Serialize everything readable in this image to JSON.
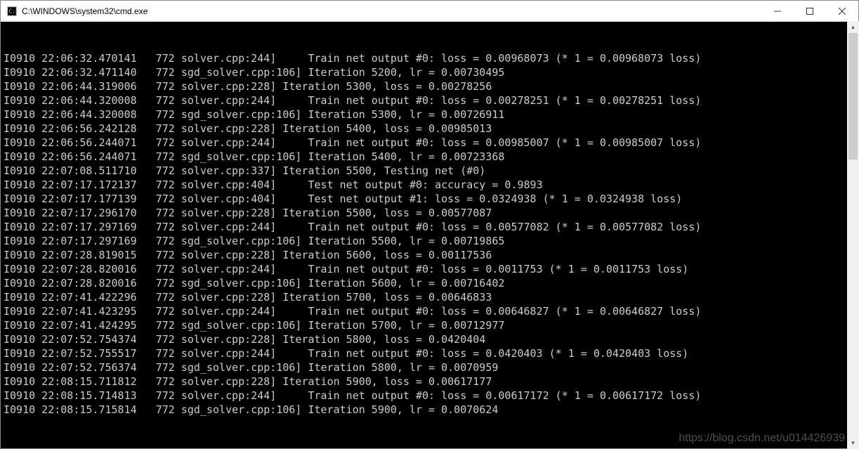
{
  "window": {
    "title": "C:\\WINDOWS\\system32\\cmd.exe"
  },
  "terminal": {
    "lines": [
      "I0910 22:06:32.470141   772 solver.cpp:244]     Train net output #0: loss = 0.00968073 (* 1 = 0.00968073 loss)",
      "I0910 22:06:32.471140   772 sgd_solver.cpp:106] Iteration 5200, lr = 0.00730495",
      "I0910 22:06:44.319006   772 solver.cpp:228] Iteration 5300, loss = 0.00278256",
      "I0910 22:06:44.320008   772 solver.cpp:244]     Train net output #0: loss = 0.00278251 (* 1 = 0.00278251 loss)",
      "I0910 22:06:44.320008   772 sgd_solver.cpp:106] Iteration 5300, lr = 0.00726911",
      "I0910 22:06:56.242128   772 solver.cpp:228] Iteration 5400, loss = 0.00985013",
      "I0910 22:06:56.244071   772 solver.cpp:244]     Train net output #0: loss = 0.00985007 (* 1 = 0.00985007 loss)",
      "I0910 22:06:56.244071   772 sgd_solver.cpp:106] Iteration 5400, lr = 0.00723368",
      "I0910 22:07:08.511710   772 solver.cpp:337] Iteration 5500, Testing net (#0)",
      "I0910 22:07:17.172137   772 solver.cpp:404]     Test net output #0: accuracy = 0.9893",
      "I0910 22:07:17.177139   772 solver.cpp:404]     Test net output #1: loss = 0.0324938 (* 1 = 0.0324938 loss)",
      "I0910 22:07:17.296170   772 solver.cpp:228] Iteration 5500, loss = 0.00577087",
      "I0910 22:07:17.297169   772 solver.cpp:244]     Train net output #0: loss = 0.00577082 (* 1 = 0.00577082 loss)",
      "I0910 22:07:17.297169   772 sgd_solver.cpp:106] Iteration 5500, lr = 0.00719865",
      "I0910 22:07:28.819015   772 solver.cpp:228] Iteration 5600, loss = 0.00117536",
      "I0910 22:07:28.820016   772 solver.cpp:244]     Train net output #0: loss = 0.0011753 (* 1 = 0.0011753 loss)",
      "I0910 22:07:28.820016   772 sgd_solver.cpp:106] Iteration 5600, lr = 0.00716402",
      "I0910 22:07:41.422296   772 solver.cpp:228] Iteration 5700, loss = 0.00646833",
      "I0910 22:07:41.423295   772 solver.cpp:244]     Train net output #0: loss = 0.00646827 (* 1 = 0.00646827 loss)",
      "I0910 22:07:41.424295   772 sgd_solver.cpp:106] Iteration 5700, lr = 0.00712977",
      "I0910 22:07:52.754374   772 solver.cpp:228] Iteration 5800, loss = 0.0420404",
      "I0910 22:07:52.755517   772 solver.cpp:244]     Train net output #0: loss = 0.0420403 (* 1 = 0.0420403 loss)",
      "I0910 22:07:52.756374   772 sgd_solver.cpp:106] Iteration 5800, lr = 0.0070959",
      "I0910 22:08:15.711812   772 solver.cpp:228] Iteration 5900, loss = 0.00617177",
      "I0910 22:08:15.714813   772 solver.cpp:244]     Train net output #0: loss = 0.00617172 (* 1 = 0.00617172 loss)",
      "I0910 22:08:15.715814   772 sgd_solver.cpp:106] Iteration 5900, lr = 0.0070624"
    ]
  },
  "watermark": "https://blog.csdn.net/u014426939"
}
